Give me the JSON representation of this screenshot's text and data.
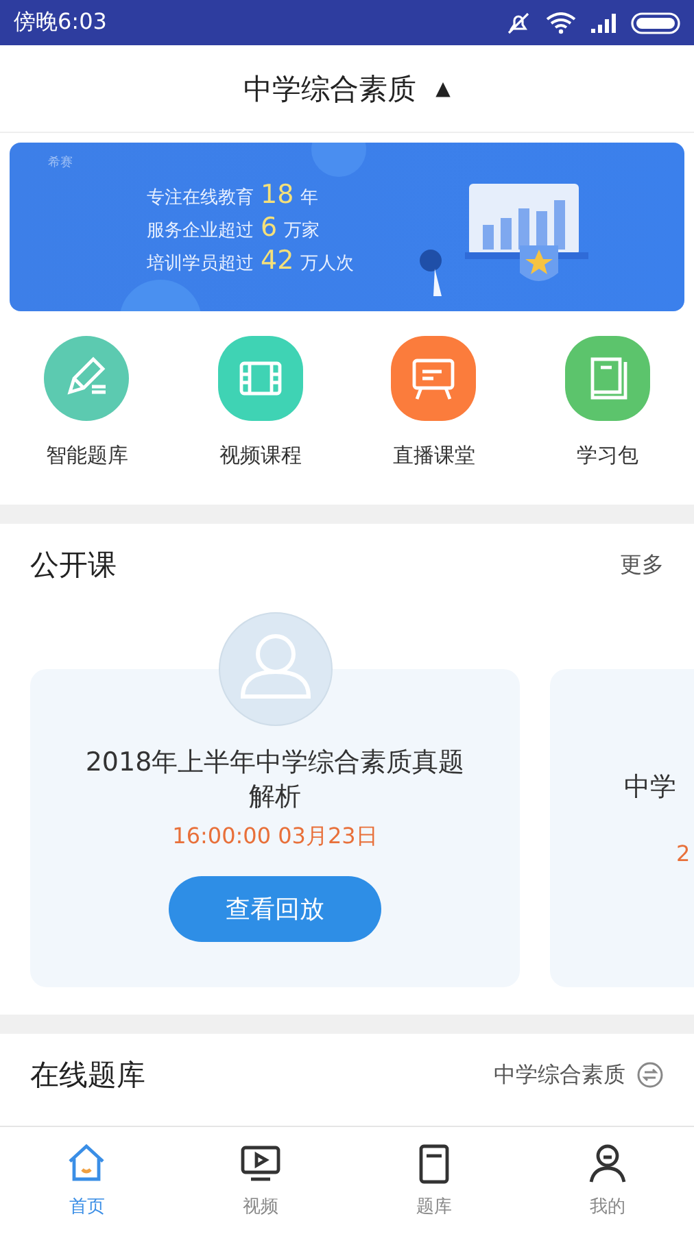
{
  "status_bar": {
    "time": "傍晚6:03"
  },
  "header": {
    "title": "中学综合素质",
    "caret": "▲"
  },
  "banner": {
    "logo": "希赛",
    "lines": [
      {
        "prefix": "专注在线教育",
        "number": "18",
        "suffix": "年"
      },
      {
        "prefix": "服务企业超过",
        "number": "6",
        "suffix": "万家"
      },
      {
        "prefix": "培训学员超过",
        "number": "42",
        "suffix": "万人次"
      }
    ]
  },
  "shortcuts": [
    {
      "label": "智能题库",
      "kind": "pencil",
      "color": "#5ccab0"
    },
    {
      "label": "视频课程",
      "kind": "film",
      "color": "#3fd3b4"
    },
    {
      "label": "直播课堂",
      "kind": "board",
      "color": "#fb7c3c"
    },
    {
      "label": "学习包",
      "kind": "book",
      "color": "#5cc46c"
    }
  ],
  "open_courses": {
    "title": "公开课",
    "more": "更多",
    "cards": [
      {
        "title": "2018年上半年中学综合素质真题解析",
        "time": "16:00:00  03月23日",
        "button": "查看回放"
      },
      {
        "title": "中学",
        "time": "2"
      }
    ]
  },
  "question_bank": {
    "title": "在线题库",
    "subject": "中学综合素质"
  },
  "tabs": [
    {
      "label": "首页",
      "kind": "home",
      "selected": true
    },
    {
      "label": "视频",
      "kind": "video",
      "selected": false
    },
    {
      "label": "题库",
      "kind": "tablet",
      "selected": false
    },
    {
      "label": "我的",
      "kind": "person",
      "selected": false
    }
  ]
}
